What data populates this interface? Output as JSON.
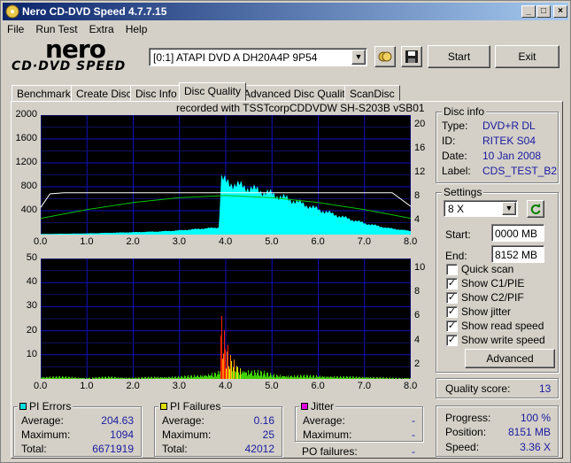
{
  "window": {
    "title": "Nero CD-DVD Speed 4.7.7.15"
  },
  "menu": [
    "File",
    "Run Test",
    "Extra",
    "Help"
  ],
  "logo": {
    "top": "nero",
    "bottom": "CD·DVD SPEED"
  },
  "drive": {
    "selected": "[0:1]  ATAPI DVD A  DH20A4P 9P54"
  },
  "buttons": {
    "start": "Start",
    "exit": "Exit",
    "advanced": "Advanced"
  },
  "tabs": [
    "Benchmark",
    "Create Disc",
    "Disc Info",
    "Disc Quality",
    "Advanced Disc Quality",
    "ScanDisc"
  ],
  "active_tab": 3,
  "recorded_with": "recorded with TSSTcorpCDDVDW SH-S203B  vSB01",
  "disc_info": {
    "title": "Disc info",
    "rows": [
      {
        "label": "Type:",
        "value": "DVD+R DL"
      },
      {
        "label": "ID:",
        "value": "RITEK S04"
      },
      {
        "label": "Date:",
        "value": "10 Jan 2008"
      },
      {
        "label": "Label:",
        "value": "CDS_TEST_B2"
      }
    ]
  },
  "settings": {
    "title": "Settings",
    "speed": "8 X",
    "start_label": "Start:",
    "start_value": "0000 MB",
    "end_label": "End:",
    "end_value": "8152 MB",
    "checks": [
      {
        "label": "Quick scan",
        "checked": false
      },
      {
        "label": "Show C1/PIE",
        "checked": true
      },
      {
        "label": "Show C2/PIF",
        "checked": true
      },
      {
        "label": "Show jitter",
        "checked": true
      },
      {
        "label": "Show read speed",
        "checked": true
      },
      {
        "label": "Show write speed",
        "checked": true
      }
    ]
  },
  "quality": {
    "label": "Quality score:",
    "value": "13"
  },
  "progress": {
    "rows": [
      {
        "label": "Progress:",
        "value": "100 %"
      },
      {
        "label": "Position:",
        "value": "8151 MB"
      },
      {
        "label": "Speed:",
        "value": "3.36 X"
      }
    ]
  },
  "pi_errors": {
    "title": "PI Errors",
    "color": "#00e0e0",
    "rows": [
      {
        "label": "Average:",
        "value": "204.63"
      },
      {
        "label": "Maximum:",
        "value": "1094"
      },
      {
        "label": "Total:",
        "value": "6671919"
      }
    ]
  },
  "pi_failures": {
    "title": "PI Failures",
    "color": "#e0e000",
    "rows": [
      {
        "label": "Average:",
        "value": "0.16"
      },
      {
        "label": "Maximum:",
        "value": "25"
      },
      {
        "label": "Total:",
        "value": "42012"
      }
    ]
  },
  "jitter": {
    "title": "Jitter",
    "color": "#e000e0",
    "rows": [
      {
        "label": "Average:",
        "value": "-"
      },
      {
        "label": "Maximum:",
        "value": "-"
      }
    ],
    "po_label": "PO failures:",
    "po_value": "-"
  },
  "chart_data": [
    {
      "type": "area",
      "x_ticks": [
        "0.0",
        "1.0",
        "2.0",
        "3.0",
        "4.0",
        "5.0",
        "6.0",
        "7.0",
        "8.0"
      ],
      "y_ticks_left": [
        "2000",
        "1600",
        "1200",
        "800",
        "400"
      ],
      "y_ticks_right": [
        "20",
        "16",
        "12",
        "8",
        "4"
      ],
      "xlim": [
        0,
        8
      ],
      "ylim": [
        0,
        2000
      ],
      "y2lim": [
        0,
        22
      ],
      "series": [
        {
          "color": "#00ffff",
          "x": [
            0,
            0.5,
            1,
            1.5,
            2,
            2.5,
            3,
            3.5,
            3.85,
            3.9,
            4.0,
            4.5,
            5,
            5.5,
            6,
            6.5,
            7,
            7.5,
            8
          ],
          "y": [
            10,
            15,
            20,
            30,
            40,
            50,
            70,
            100,
            120,
            950,
            880,
            780,
            680,
            560,
            420,
            300,
            190,
            110,
            60
          ]
        },
        {
          "color": "#00c000",
          "x": [
            0,
            1,
            2,
            3,
            4,
            5,
            6,
            7,
            8
          ],
          "y2": [
            3.0,
            4.6,
            5.9,
            6.8,
            7.2,
            6.8,
            5.9,
            4.6,
            3.0
          ]
        },
        {
          "color": "#ffffff",
          "x": [
            0,
            0.2,
            0.5,
            1,
            2,
            3,
            3.8,
            4.2,
            5,
            6,
            7,
            7.6,
            8
          ],
          "y2": [
            5.0,
            7.5,
            7.7,
            7.7,
            7.7,
            7.7,
            7.7,
            7.7,
            7.7,
            7.7,
            7.7,
            7.7,
            5.2
          ]
        }
      ]
    },
    {
      "type": "bar",
      "x_ticks": [
        "0.0",
        "1.0",
        "2.0",
        "3.0",
        "4.0",
        "5.0",
        "6.0",
        "7.0",
        "8.0"
      ],
      "y_ticks_left": [
        "50",
        "40",
        "30",
        "20",
        "10"
      ],
      "y_ticks_right": [
        "10",
        "8",
        "6",
        "4",
        "2"
      ],
      "xlim": [
        0,
        8
      ],
      "ylim": [
        0,
        50
      ],
      "series": [
        {
          "x": [
            0,
            0.5,
            1,
            1.5,
            2,
            2.5,
            3,
            3.5,
            3.85,
            3.9,
            3.95,
            4.0,
            4.05,
            4.1,
            4.2,
            4.3,
            4.5,
            4.8,
            5,
            5.5,
            6,
            6.5,
            7,
            7.5,
            8
          ],
          "y": [
            1,
            1,
            0.5,
            1,
            0.5,
            1,
            1,
            2,
            3,
            25,
            18,
            14,
            12,
            9,
            7,
            5,
            4,
            3,
            2,
            1.5,
            1.5,
            1,
            1,
            0.5,
            0.5
          ]
        }
      ]
    }
  ]
}
